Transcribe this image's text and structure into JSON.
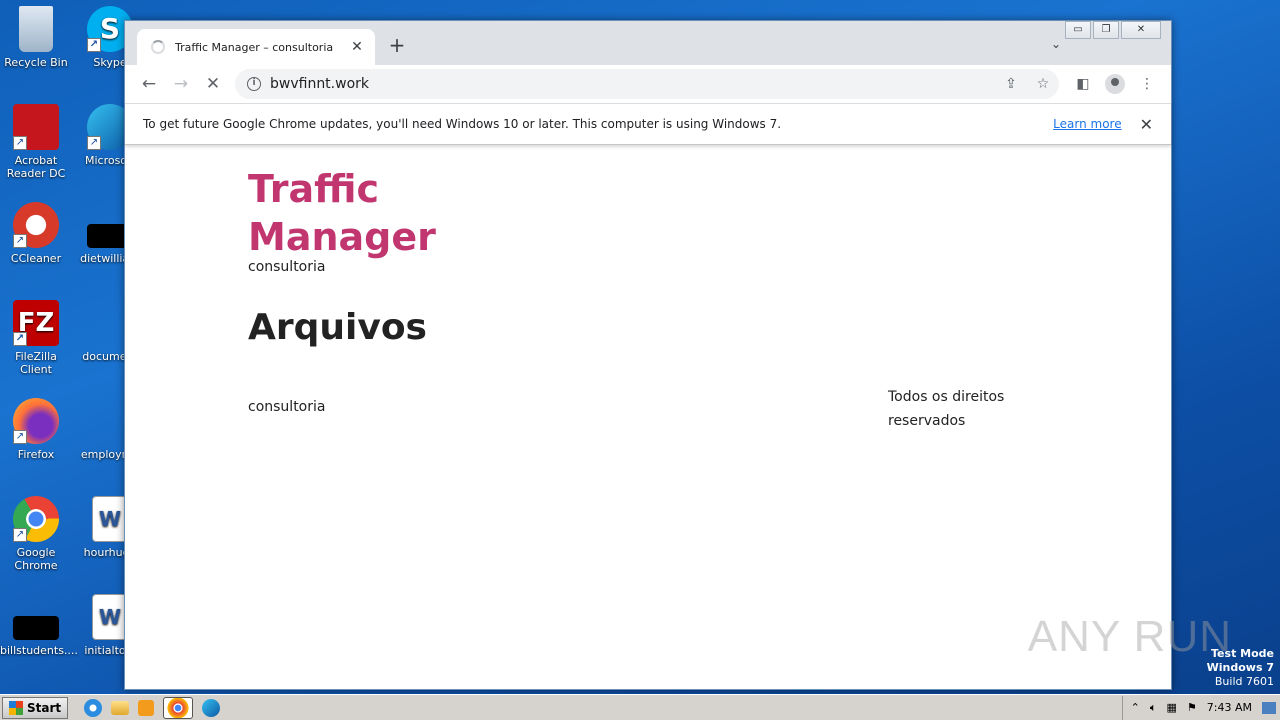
{
  "desktop": {
    "icons": [
      {
        "label": "Recycle Bin"
      },
      {
        "label": "Skype"
      },
      {
        "label": "Acrobat Reader DC"
      },
      {
        "label": "Microsoft"
      },
      {
        "label": "CCleaner"
      },
      {
        "label": "dietwilliam"
      },
      {
        "label": "FileZilla Client"
      },
      {
        "label": "document"
      },
      {
        "label": "Firefox"
      },
      {
        "label": "employme"
      },
      {
        "label": "Google Chrome"
      },
      {
        "label": "hourhuge"
      },
      {
        "label": "billstudents...."
      },
      {
        "label": "initialtold"
      }
    ]
  },
  "browser": {
    "tab_title": "Traffic Manager – consultoria",
    "url": "bwvfinnt.work",
    "infobar": {
      "message": "To get future Google Chrome updates, you'll need Windows 10 or later. This computer is using Windows 7.",
      "learn_more": "Learn more"
    }
  },
  "page": {
    "site_title": "Traffic Manager",
    "site_subtitle": "consultoria",
    "heading": "Arquivos",
    "footer_left": "consultoria",
    "footer_right": "Todos os direitos reservados"
  },
  "watermark": "ANY RUN",
  "os": {
    "test_mode_line1": "Test Mode",
    "test_mode_line2": "Windows 7",
    "build": "Build 7601",
    "start_label": "Start",
    "clock": "7:43 AM"
  },
  "colors": {
    "site_title": "#c1366f",
    "link": "#1a73e8",
    "desktop": "#1a73d0"
  }
}
